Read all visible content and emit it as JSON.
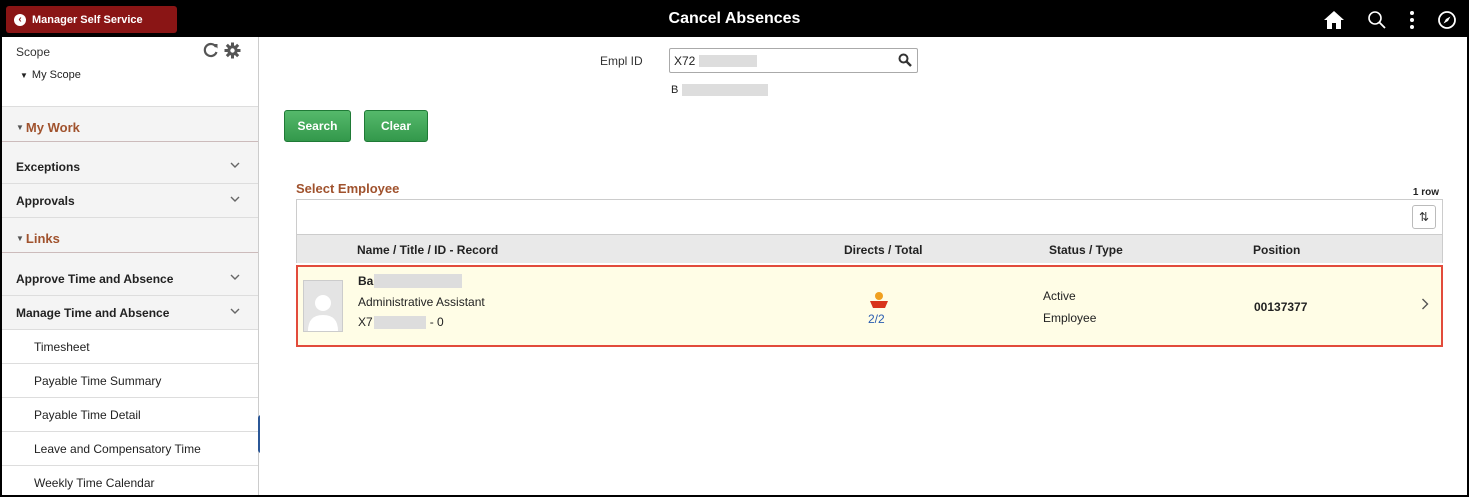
{
  "header": {
    "back_label": "Manager Self Service",
    "title": "Cancel Absences",
    "icons": [
      "home-icon",
      "search-icon",
      "more-vertical-icon",
      "navbar-compass-icon"
    ]
  },
  "sidebar": {
    "scope_label": "Scope",
    "scope_item": "My Scope",
    "my_work_label": "My Work",
    "work_items": [
      {
        "label": "Exceptions"
      },
      {
        "label": "Approvals"
      }
    ],
    "links_label": "Links",
    "link_items": [
      {
        "label": "Approve Time and Absence"
      },
      {
        "label": "Manage Time and Absence"
      }
    ],
    "sub_items": [
      {
        "label": "Timesheet"
      },
      {
        "label": "Payable Time Summary"
      },
      {
        "label": "Payable Time Detail"
      },
      {
        "label": "Leave and Compensatory Time"
      },
      {
        "label": "Weekly Time Calendar"
      }
    ]
  },
  "search": {
    "empl_id_label": "Empl ID",
    "empl_id_value": "X72",
    "empl_name_initial": "B",
    "search_button": "Search",
    "clear_button": "Clear"
  },
  "grid": {
    "title": "Select Employee",
    "row_count": "1 row",
    "columns": [
      "Name / Title / ID - Record",
      "Directs / Total",
      "Status / Type",
      "Position"
    ],
    "rows": [
      {
        "name_initial": "Ba",
        "title": "Administrative Assistant",
        "id_prefix": "X7",
        "record": "- 0",
        "directs": "2/2",
        "status": "Active",
        "type": "Employee",
        "position": "00137377"
      }
    ]
  },
  "colors": {
    "brand_red": "#8a1515",
    "section_heading": "#a0522d",
    "button_green": "#33984b",
    "highlight_border": "#e24b3b",
    "row_highlight": "#fffde6"
  }
}
